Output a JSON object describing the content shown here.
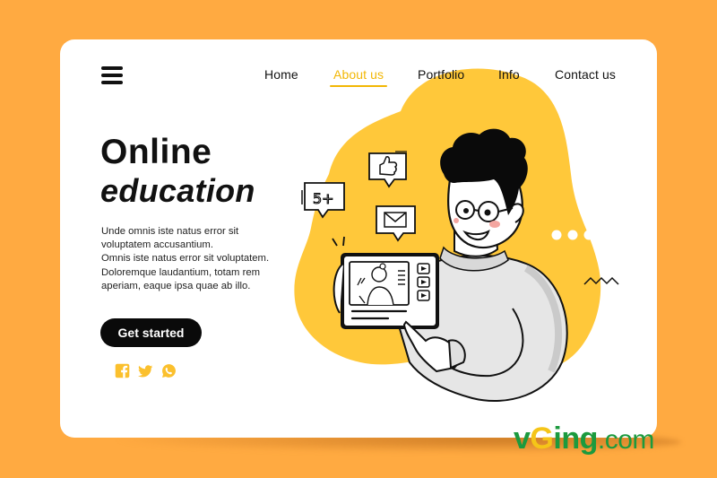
{
  "colors": {
    "background": "#FFAA41",
    "card": "#FFFFFF",
    "accent_yellow": "#F2B705",
    "blob_yellow": "#FFC83A",
    "text_dark": "#111111",
    "button_bg": "#0A0A0A",
    "social_icon": "#FBC02D",
    "watermark_green": "#1C9A3E",
    "watermark_yellow": "#F5C518"
  },
  "header": {
    "menu_icon": "hamburger-menu-icon",
    "nav": [
      {
        "label": "Home",
        "active": false
      },
      {
        "label": "About us",
        "active": true
      },
      {
        "label": "Portfolio",
        "active": false
      },
      {
        "label": "Info",
        "active": false
      },
      {
        "label": "Contact us",
        "active": false
      }
    ]
  },
  "hero": {
    "title_line1": "Online",
    "title_line2": "education",
    "body_lines": [
      "Unde omnis iste natus error sit",
      "voluptatem accusantium.",
      "Omnis iste natus error sit voluptatem.",
      "Doloremque laudantium, totam rem",
      "aperiam, eaque ipsa quae ab illo."
    ],
    "cta_label": "Get started",
    "socials": [
      {
        "icon": "facebook-icon"
      },
      {
        "icon": "twitter-icon"
      },
      {
        "icon": "whatsapp-icon"
      }
    ]
  },
  "illustration": {
    "bubble_count_label": "5+",
    "bubble_like_icon": "thumbs-up-icon",
    "bubble_mail_icon": "envelope-icon",
    "tablet_play_icons": [
      "play-icon",
      "play-icon",
      "play-icon"
    ],
    "typing_dots_icon": "ellipsis-icon",
    "zigzag_icon": "zigzag-icon"
  },
  "watermark": {
    "part1": "v",
    "part2": "G",
    "part3": "ing",
    "part4": ".com"
  }
}
